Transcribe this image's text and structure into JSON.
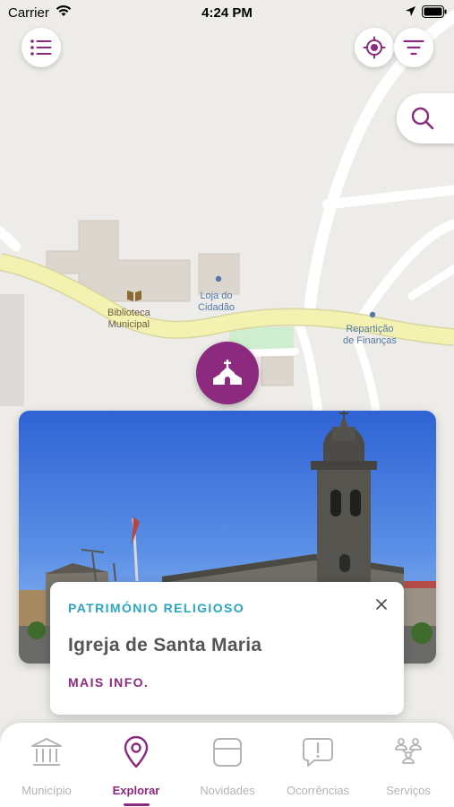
{
  "status_bar": {
    "carrier": "Carrier",
    "time": "4:24 PM"
  },
  "map": {
    "labels": {
      "library_line1": "Biblioteca",
      "library_line2": "Municipal",
      "citizen_store_line1": "Loja do",
      "citizen_store_line2": "Cidadão",
      "finance_office_line1": "Repartição",
      "finance_office_line2": "de Finanças"
    },
    "pin_icon": "church-icon"
  },
  "poi": {
    "category": "PATRIMÓNIO RELIGIOSO",
    "title": "Igreja de Santa Maria",
    "more_info": "MAIS INFO.",
    "close_symbol": "×"
  },
  "tabs": [
    {
      "label": "Município",
      "icon": "town-hall-icon",
      "active": false
    },
    {
      "label": "Explorar",
      "icon": "map-pin-icon",
      "active": true
    },
    {
      "label": "Novidades",
      "icon": "news-icon",
      "active": false
    },
    {
      "label": "Ocorrências",
      "icon": "report-icon",
      "active": false
    },
    {
      "label": "Serviços",
      "icon": "services-icon",
      "active": false
    }
  ],
  "colors": {
    "accent": "#8b2a7e",
    "category": "#2aa4c4",
    "tab_inactive": "#b4b4b4",
    "map_background": "#eeece8",
    "main_road": "#f4f2b0"
  }
}
